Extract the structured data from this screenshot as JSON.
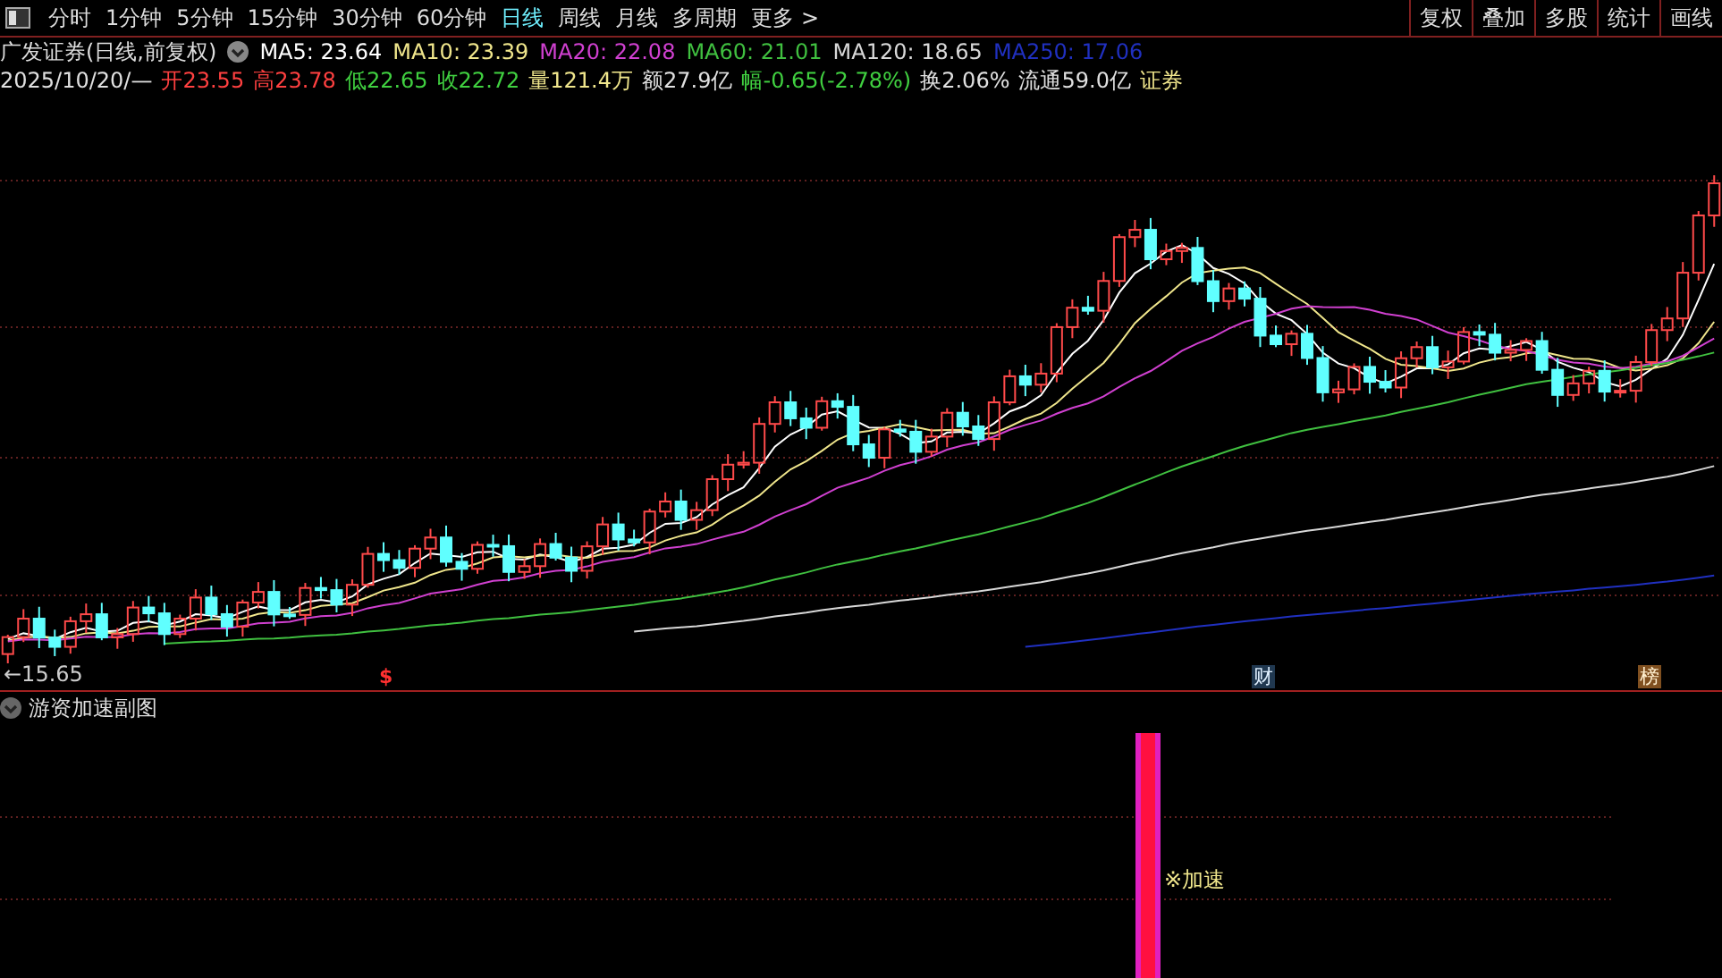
{
  "toolbar": {
    "periods": [
      {
        "label": "分时",
        "selected": false
      },
      {
        "label": "1分钟",
        "selected": false
      },
      {
        "label": "5分钟",
        "selected": false
      },
      {
        "label": "15分钟",
        "selected": false
      },
      {
        "label": "30分钟",
        "selected": false
      },
      {
        "label": "60分钟",
        "selected": false
      },
      {
        "label": "日线",
        "selected": true
      },
      {
        "label": "周线",
        "selected": false
      },
      {
        "label": "月线",
        "selected": false
      },
      {
        "label": "多周期",
        "selected": false
      },
      {
        "label": "更多 >",
        "selected": false
      }
    ],
    "buttons": [
      "复权",
      "叠加",
      "多股",
      "统计",
      "画线"
    ]
  },
  "title": "广发证券(日线,前复权)",
  "moving_averages": [
    {
      "label": "MA5: 23.64",
      "color": "#ffffff"
    },
    {
      "label": "MA10: 23.39",
      "color": "#f0e68c"
    },
    {
      "label": "MA20: 22.08",
      "color": "#d040d0"
    },
    {
      "label": "MA60: 21.01",
      "color": "#40c040"
    },
    {
      "label": "MA120: 18.65",
      "color": "#d8d8d8"
    },
    {
      "label": "MA250: 17.06",
      "color": "#2030c0"
    }
  ],
  "quote": [
    {
      "text": "2025/10/20/—",
      "color": "#e0e0e0"
    },
    {
      "text": "开23.55",
      "color": "#ff4040"
    },
    {
      "text": "高23.78",
      "color": "#ff4040"
    },
    {
      "text": "低22.65",
      "color": "#40d040"
    },
    {
      "text": "收22.72",
      "color": "#40d040"
    },
    {
      "text": "量121.4万",
      "color": "#f0e68c"
    },
    {
      "text": "额27.9亿",
      "color": "#e0e0e0"
    },
    {
      "text": "幅-0.65(-2.78%)",
      "color": "#40d040"
    },
    {
      "text": "换2.06%",
      "color": "#e0e0e0"
    },
    {
      "text": "流通59.0亿",
      "color": "#e0e0e0"
    },
    {
      "text": "证券",
      "color": "#f0e68c"
    }
  ],
  "main_chart": {
    "low_label": "←15.65",
    "markers": [
      {
        "kind": "dollar",
        "text": "$"
      },
      {
        "kind": "finance",
        "text": "财"
      },
      {
        "kind": "ranking",
        "text": "榜"
      }
    ]
  },
  "sub_chart": {
    "title": "游资加速副图",
    "signal_label": "※加速"
  }
}
